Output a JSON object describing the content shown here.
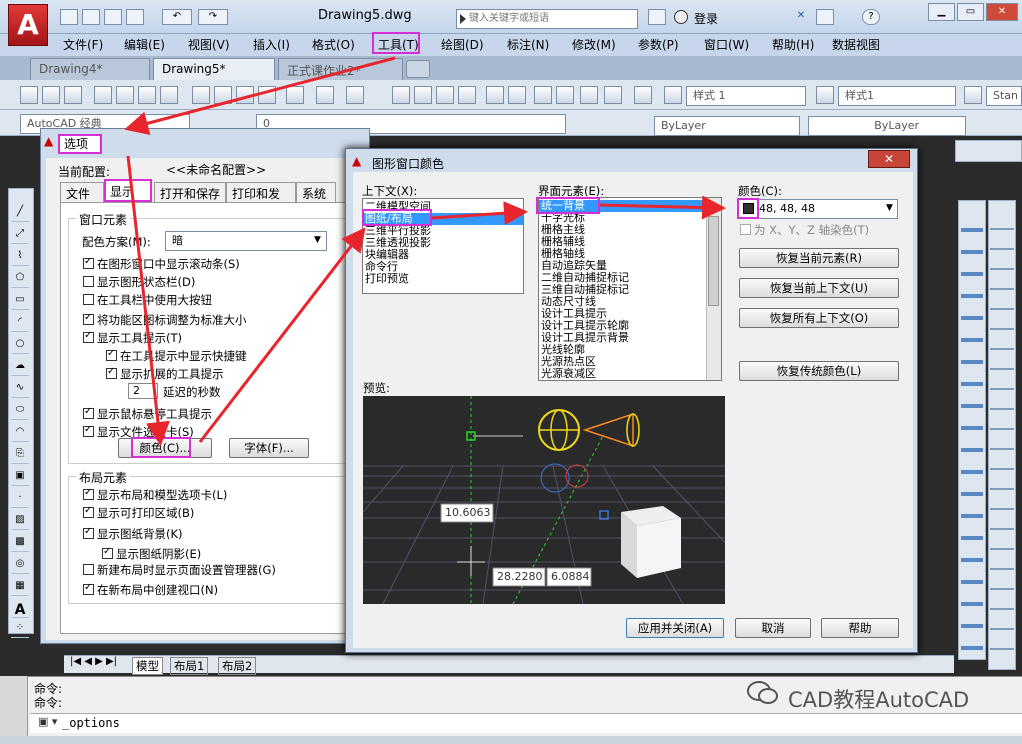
{
  "app": {
    "logo": "A",
    "doc_title": "Drawing5.dwg",
    "search_placeholder": "键入关键字或短语",
    "login": "登录"
  },
  "menu": [
    "文件(F)",
    "编辑(E)",
    "视图(V)",
    "插入(I)",
    "格式(O)",
    "工具(T)",
    "绘图(D)",
    "标注(N)",
    "修改(M)",
    "参数(P)",
    "窗口(W)",
    "帮助(H)",
    "数据视图"
  ],
  "tabs": [
    "Drawing4*",
    "Drawing5*",
    "正式课作业2*"
  ],
  "toolbar": {
    "style1": "样式 1",
    "style2": "样式1",
    "style3": "Stan",
    "workspace": "AutoCAD 经典",
    "layer": "0",
    "bylayer1": "ByLayer",
    "bylayer2": "ByLayer"
  },
  "layout_tabs": [
    "模型",
    "布局1",
    "布局2"
  ],
  "command": {
    "line1": "命令:",
    "line2": "命令:",
    "input": "_options"
  },
  "watermark": "CAD教程AutoCAD",
  "options_dialog": {
    "title": "选项",
    "profile_label": "当前配置:",
    "profile_value": "<<未命名配置>>",
    "tabs": [
      "文件",
      "显示",
      "打开和保存",
      "打印和发布",
      "系统"
    ],
    "window_group": "窗口元素",
    "color_scheme_label": "配色方案(M):",
    "color_scheme_value": "暗",
    "window_options": [
      {
        "label": "在图形窗口中显示滚动条(S)",
        "checked": true
      },
      {
        "label": "显示图形状态栏(D)",
        "checked": false
      },
      {
        "label": "在工具栏中使用大按钮",
        "checked": false
      },
      {
        "label": "将功能区图标调整为标准大小",
        "checked": true
      },
      {
        "label": "显示工具提示(T)",
        "checked": true
      }
    ],
    "tooltip_shortcut": "在工具提示中显示快捷键",
    "tooltip_extended": "显示扩展的工具提示",
    "delay_value": "2",
    "delay_label": "延迟的秒数",
    "rollover": "显示鼠标悬停工具提示",
    "file_tabs": "显示文件选项卡(S)",
    "colors_btn": "颜色(C)...",
    "fonts_btn": "字体(F)...",
    "layout_group": "布局元素",
    "layout_options": [
      {
        "label": "显示布局和模型选项卡(L)",
        "checked": true
      },
      {
        "label": "显示可打印区域(B)",
        "checked": true
      },
      {
        "label": "显示图纸背景(K)",
        "checked": true
      }
    ],
    "paper_shadow": "显示图纸阴影(E)",
    "new_layout_page_setup": "新建布局时显示页面设置管理器(G)",
    "create_viewport": "在新布局中创建视口(N)"
  },
  "color_dialog": {
    "title": "图形窗口颜色",
    "context_label": "上下文(X):",
    "contexts": [
      "二维模型空间",
      "图纸/布局",
      "三维平行投影",
      "三维透视投影",
      "块编辑器",
      "命令行",
      "打印预览"
    ],
    "element_label": "界面元素(E):",
    "elements": [
      "统一背景",
      "十字光标",
      "栅格主线",
      "栅格辅线",
      "栅格轴线",
      "自动追踪矢量",
      "二维自动捕捉标记",
      "三维自动捕捉标记",
      "动态尺寸线",
      "设计工具提示",
      "设计工具提示轮廓",
      "设计工具提示背景",
      "光线轮廓",
      "光源热点区",
      "光源衰减区"
    ],
    "color_label": "颜色(C):",
    "color_value": "48, 48, 48",
    "tint_label": "为 X、Y、Z 轴染色(T)",
    "btn_restore_element": "恢复当前元素(R)",
    "btn_restore_context": "恢复当前上下文(U)",
    "btn_restore_all": "恢复所有上下文(O)",
    "btn_restore_classic": "恢复传统颜色(L)",
    "preview_label": "预览:",
    "preview_values": [
      "10.6063",
      "28.2280",
      "6.0884"
    ],
    "btn_apply": "应用并关闭(A)",
    "btn_cancel": "取消",
    "btn_help": "帮助"
  },
  "colors": {
    "highlight": "#d52fd5",
    "arrow": "#e8242c",
    "selection": "#3399ff"
  }
}
